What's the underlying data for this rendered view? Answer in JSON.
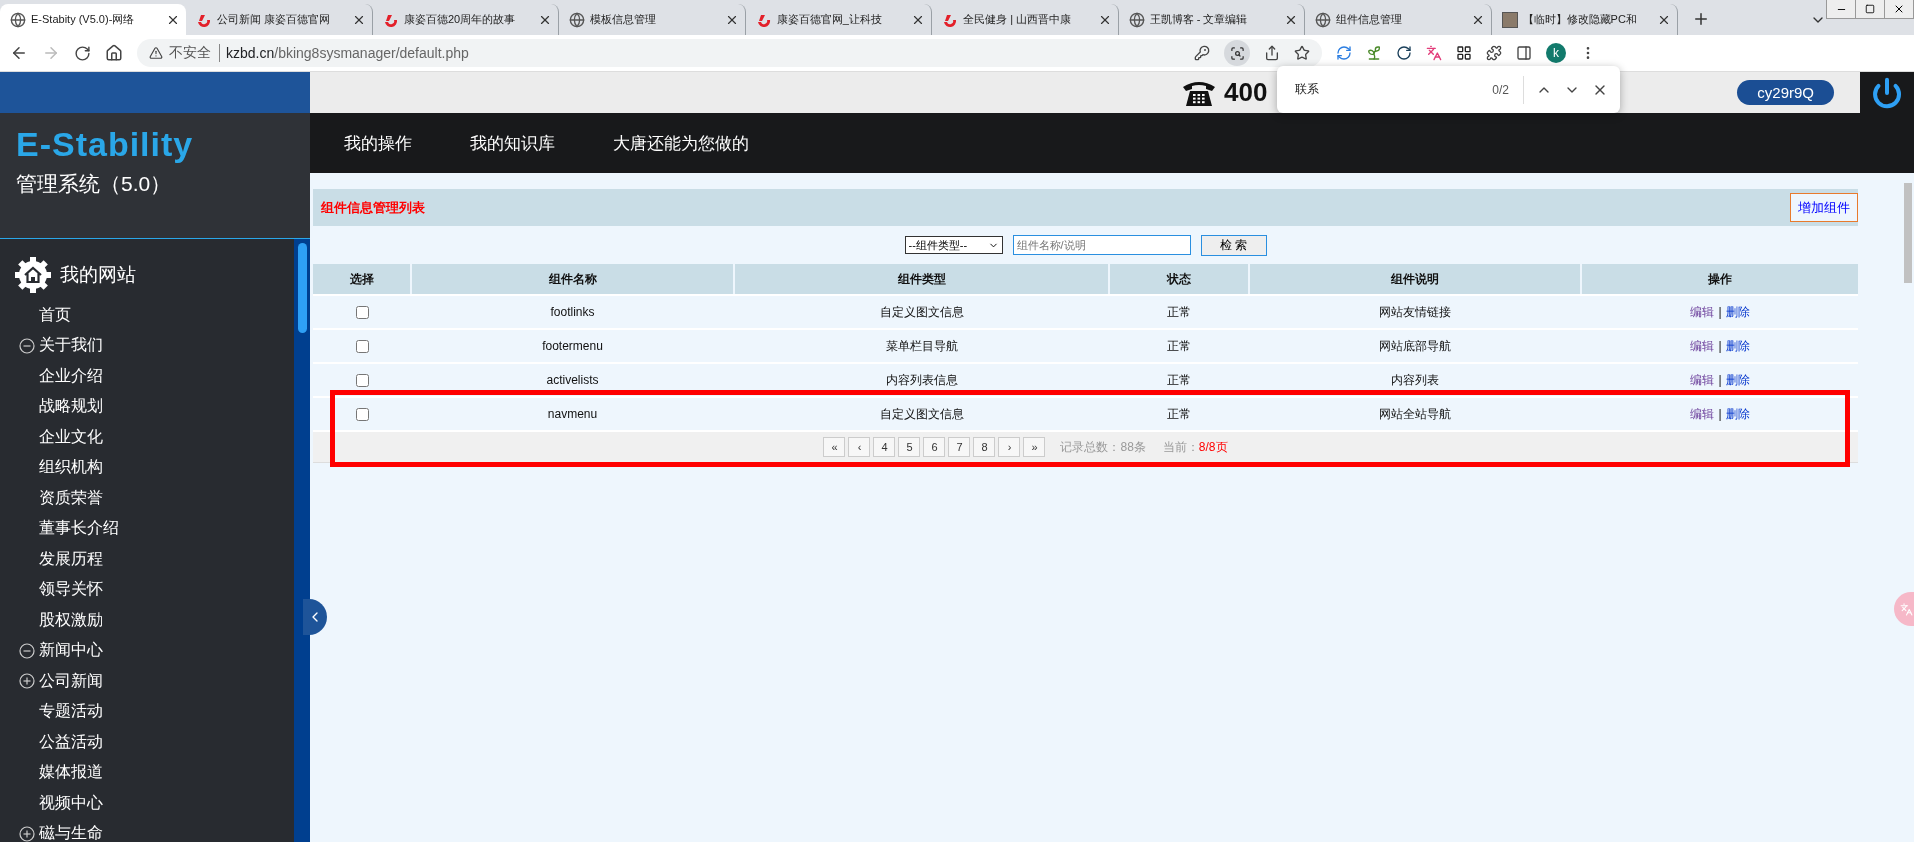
{
  "browser": {
    "tabs": [
      {
        "title": "E-Stabity (V5.0)-网络",
        "kind": "globe",
        "selected": true
      },
      {
        "title": "公司新闻 康姿百德官网",
        "kind": "brand",
        "selected": false
      },
      {
        "title": "康姿百德20周年的故事",
        "kind": "brand",
        "selected": false
      },
      {
        "title": "模板信息管理",
        "kind": "globe",
        "selected": false
      },
      {
        "title": "康姿百德官网_让科技",
        "kind": "brand",
        "selected": false
      },
      {
        "title": "全民健身 | 山西晋中康",
        "kind": "brand",
        "selected": false
      },
      {
        "title": "王凯博客 - 文章编辑",
        "kind": "globe",
        "selected": false
      },
      {
        "title": "组件信息管理",
        "kind": "globe",
        "selected": false
      },
      {
        "title": "【临时】修改隐藏PC和",
        "kind": "photo",
        "selected": false
      }
    ],
    "security_label": "不安全",
    "url_host": "kzbd.cn",
    "url_path": "/bking8sysmanager/default.php",
    "profile_initial": "k"
  },
  "find_bar": {
    "query": "联系",
    "count": "0/2"
  },
  "header": {
    "phone": "400",
    "user": "cy29r9Q"
  },
  "nav": [
    "我的操作",
    "我的知识库",
    "大唐还能为您做的"
  ],
  "sidebar": {
    "logo": "E-Stability",
    "subtitle": "管理系统（5.0）",
    "section": "我的网站",
    "items": [
      {
        "label": "首页"
      },
      {
        "label": "关于我们",
        "expanded": true,
        "children": [
          {
            "label": "企业介绍"
          },
          {
            "label": "战略规划"
          },
          {
            "label": "企业文化"
          },
          {
            "label": "组织机构"
          },
          {
            "label": "资质荣誉"
          },
          {
            "label": "董事长介绍"
          },
          {
            "label": "发展历程"
          },
          {
            "label": "领导关怀"
          },
          {
            "label": "股权激励"
          }
        ]
      },
      {
        "label": "新闻中心",
        "expanded": true,
        "children": [
          {
            "label": "公司新闻",
            "expanded": false
          },
          {
            "label": "专题活动"
          },
          {
            "label": "公益活动"
          },
          {
            "label": "媒体报道"
          },
          {
            "label": "视频中心"
          }
        ]
      },
      {
        "label": "磁与生命",
        "expanded": false
      }
    ]
  },
  "panel": {
    "title": "组件信息管理列表",
    "add_button": "增加组件",
    "type_select": "--组件类型--",
    "search_placeholder": "组件名称/说明",
    "search_button": "检 索"
  },
  "table": {
    "columns": [
      "选择",
      "组件名称",
      "组件类型",
      "状态",
      "组件说明",
      "操作"
    ],
    "action_separator": "|",
    "rows": [
      {
        "checked": false,
        "name": "footlinks",
        "type": "自定义图文信息",
        "status": "正常",
        "description": "网站友情链接",
        "actions": [
          {
            "label": "编辑",
            "visited": true
          },
          {
            "label": "删除",
            "visited": false
          }
        ]
      },
      {
        "checked": false,
        "name": "footermenu",
        "type": "菜单栏目导航",
        "status": "正常",
        "description": "网站底部导航",
        "actions": [
          {
            "label": "编辑",
            "visited": true
          },
          {
            "label": "删除",
            "visited": false
          }
        ]
      },
      {
        "checked": false,
        "name": "activelists",
        "type": "内容列表信息",
        "status": "正常",
        "description": "内容列表",
        "actions": [
          {
            "label": "编辑",
            "visited": true
          },
          {
            "label": "删除",
            "visited": false
          }
        ]
      },
      {
        "checked": false,
        "name": "navmenu",
        "type": "自定义图文信息",
        "status": "正常",
        "description": "网站全站导航",
        "actions": [
          {
            "label": "编辑",
            "visited": true
          },
          {
            "label": "删除",
            "visited": false
          }
        ]
      }
    ]
  },
  "pagination": {
    "pages": [
      "«",
      "‹",
      "4",
      "5",
      "6",
      "7",
      "8",
      "›",
      "»"
    ],
    "total": "记录总数：88条",
    "current_label": "当前：",
    "current_value": "8/8页"
  }
}
